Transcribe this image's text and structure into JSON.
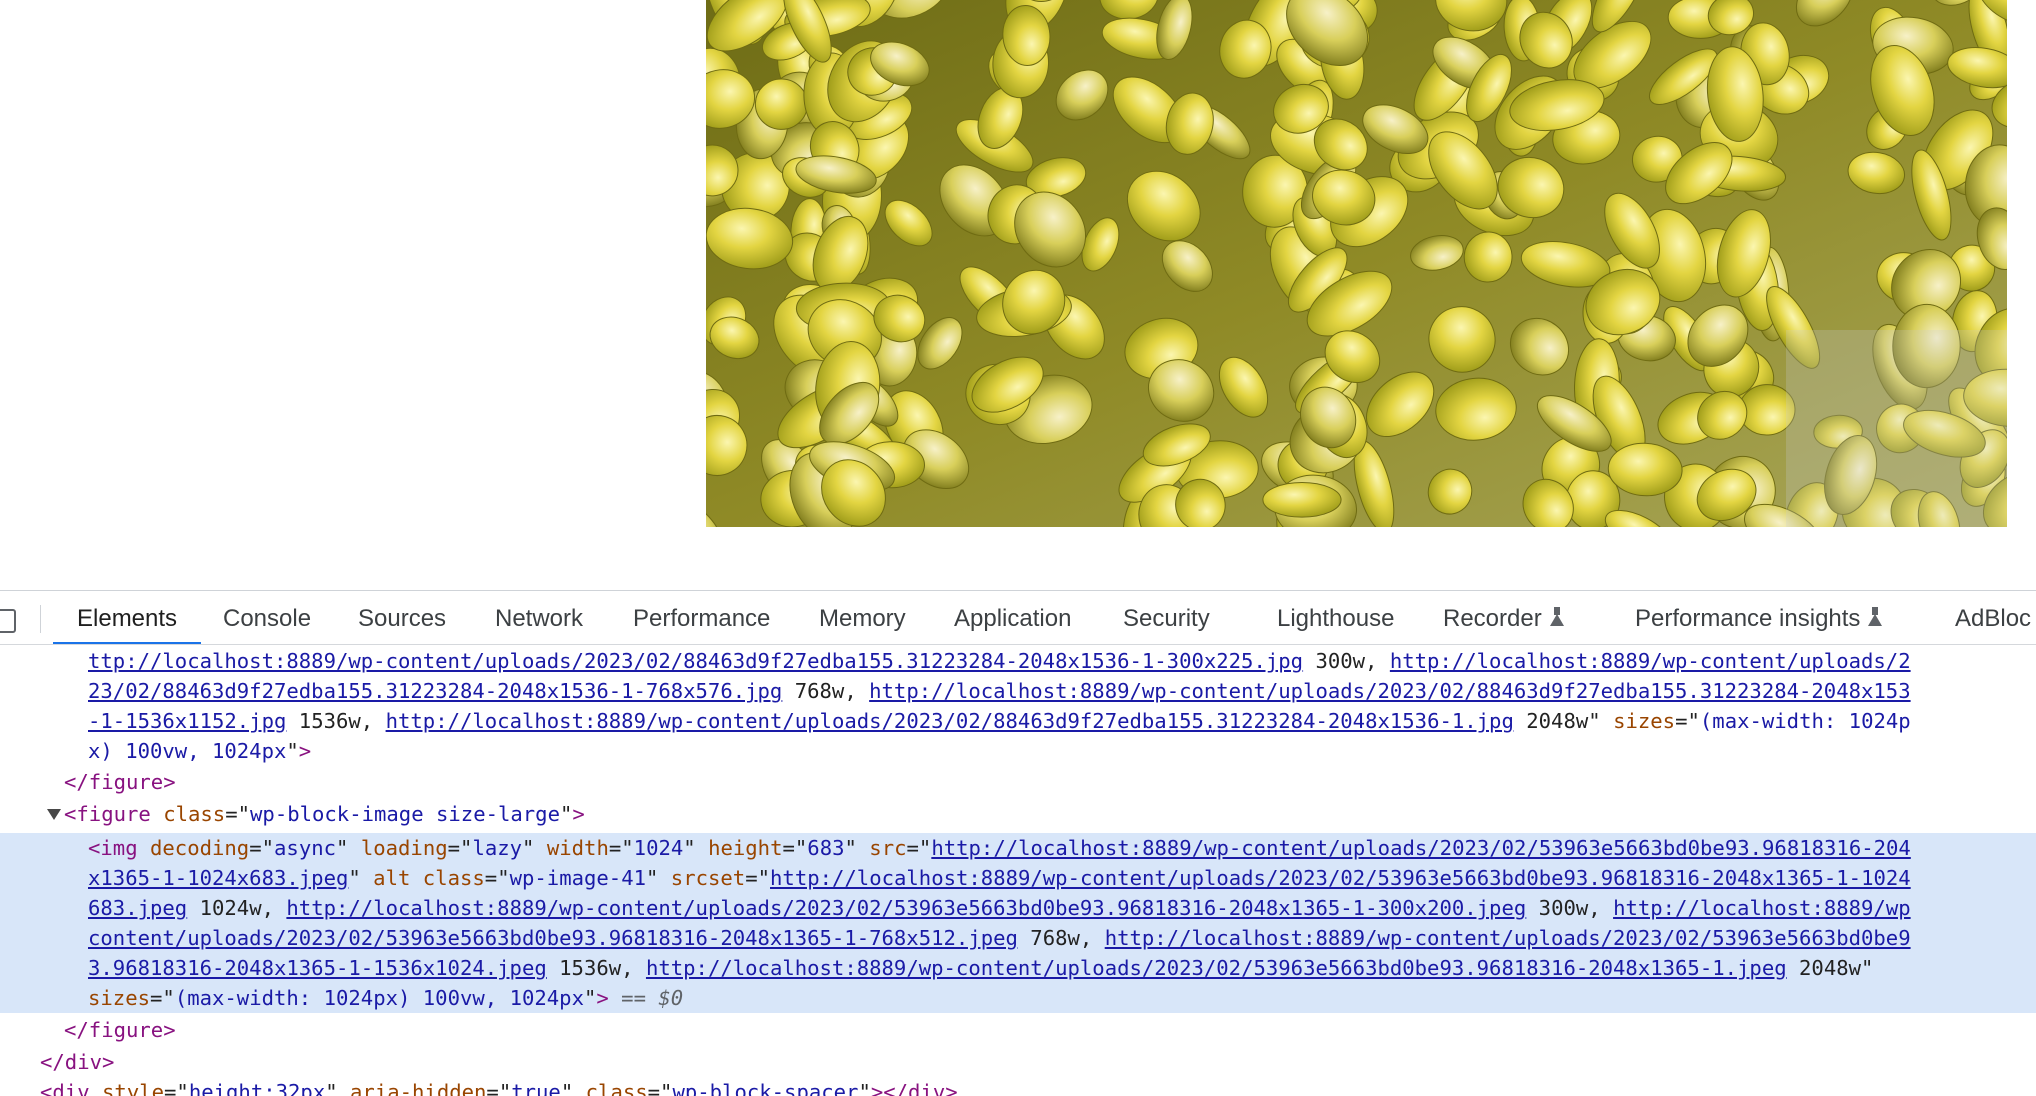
{
  "page": {
    "image_alt": "Close-up photo of yellow corn kernels"
  },
  "devtools": {
    "tabs": [
      {
        "label": "Elements",
        "active": true
      },
      {
        "label": "Console"
      },
      {
        "label": "Sources"
      },
      {
        "label": "Network"
      },
      {
        "label": "Performance"
      },
      {
        "label": "Memory"
      },
      {
        "label": "Application"
      },
      {
        "label": "Security"
      },
      {
        "label": "Lighthouse"
      },
      {
        "label": "Recorder",
        "icon": "flask-icon"
      },
      {
        "label": "Performance insights",
        "icon": "flask-icon"
      },
      {
        "label": "AdBloc"
      }
    ],
    "dom": {
      "l1": {
        "link1": "ttp://localhost:8889/wp-content/uploads/2023/02/88463d9f27edba155.31223284-2048x1536-1-300x225.jpg",
        "t1": " 300w, ",
        "link2": "http://localhost:8889/wp-content/uploads/2"
      },
      "l2": {
        "link1": "23/02/88463d9f27edba155.31223284-2048x1536-1-768x576.jpg",
        "t1": " 768w, ",
        "link2": "http://localhost:8889/wp-content/uploads/2023/02/88463d9f27edba155.31223284-2048x153"
      },
      "l3": {
        "link1": "-1-1536x1152.jpg",
        "t1": " 1536w, ",
        "link2": "http://localhost:8889/wp-content/uploads/2023/02/88463d9f27edba155.31223284-2048x1536-1.jpg",
        "t2": " 2048w",
        "q": "\" ",
        "an": "sizes",
        "eq": "=\"",
        "av": "(max-width: 1024p"
      },
      "l4": {
        "av": "x) 100vw, 1024px",
        "q": "\"",
        "tag": ">"
      },
      "l5": {
        "tag": "</figure>"
      },
      "l6": {
        "tag_open": "<figure",
        "an": " class",
        "eq": "=\"",
        "av": "wp-block-image size-large",
        "q": "\"",
        "tag_close": ">"
      },
      "l7": {
        "tag_open": "<img",
        "an1": " decoding",
        "av1": "async",
        "an2": " loading",
        "av2": "lazy",
        "an3": " width",
        "av3": "1024",
        "an4": " height",
        "av4": "683",
        "an5": " src",
        "link": "http://localhost:8889/wp-content/uploads/2023/02/53963e5663bd0be93.96818316-204"
      },
      "l8": {
        "link": "x1365-1-1024x683.jpeg",
        "an1": " alt",
        "an2": " class",
        "av2": "wp-image-41",
        "an3": " srcset",
        "link2": "http://localhost:8889/wp-content/uploads/2023/02/53963e5663bd0be93.96818316-2048x1365-1-1024"
      },
      "l9": {
        "link1": "683.jpeg",
        "t1": " 1024w, ",
        "link2": "http://localhost:8889/wp-content/uploads/2023/02/53963e5663bd0be93.96818316-2048x1365-1-300x200.jpeg",
        "t2": " 300w, ",
        "link3": "http://localhost:8889/wp"
      },
      "l10": {
        "link1": "content/uploads/2023/02/53963e5663bd0be93.96818316-2048x1365-1-768x512.jpeg",
        "t1": " 768w, ",
        "link2": "http://localhost:8889/wp-content/uploads/2023/02/53963e5663bd0be9"
      },
      "l11": {
        "link1": "3.96818316-2048x1365-1-1536x1024.jpeg",
        "t1": " 1536w, ",
        "link2": "http://localhost:8889/wp-content/uploads/2023/02/53963e5663bd0be93.96818316-2048x1365-1.jpeg",
        "t2": " 2048w",
        "q": "\""
      },
      "l12": {
        "an": "sizes",
        "av": "(max-width: 1024px) 100vw, 1024px",
        "tag": ">",
        "eq0": " == $0"
      },
      "l13": {
        "tag": "</figure>"
      },
      "l14": {
        "tag": "</div>"
      },
      "l15": {
        "tag_open": "<div",
        "an1": " style",
        "av1": "height:32px",
        "an2": " aria-hidden",
        "av2": "true",
        "an3": " class",
        "av3": "wp-block-spacer",
        "tag_close": "></div>"
      }
    }
  },
  "colors": {
    "tab_active_underline": "#1a73e8",
    "selected_row_bg": "#d8e6f9",
    "tag": "#881280",
    "attr_name": "#994500",
    "attr_value": "#1a1aa6"
  }
}
